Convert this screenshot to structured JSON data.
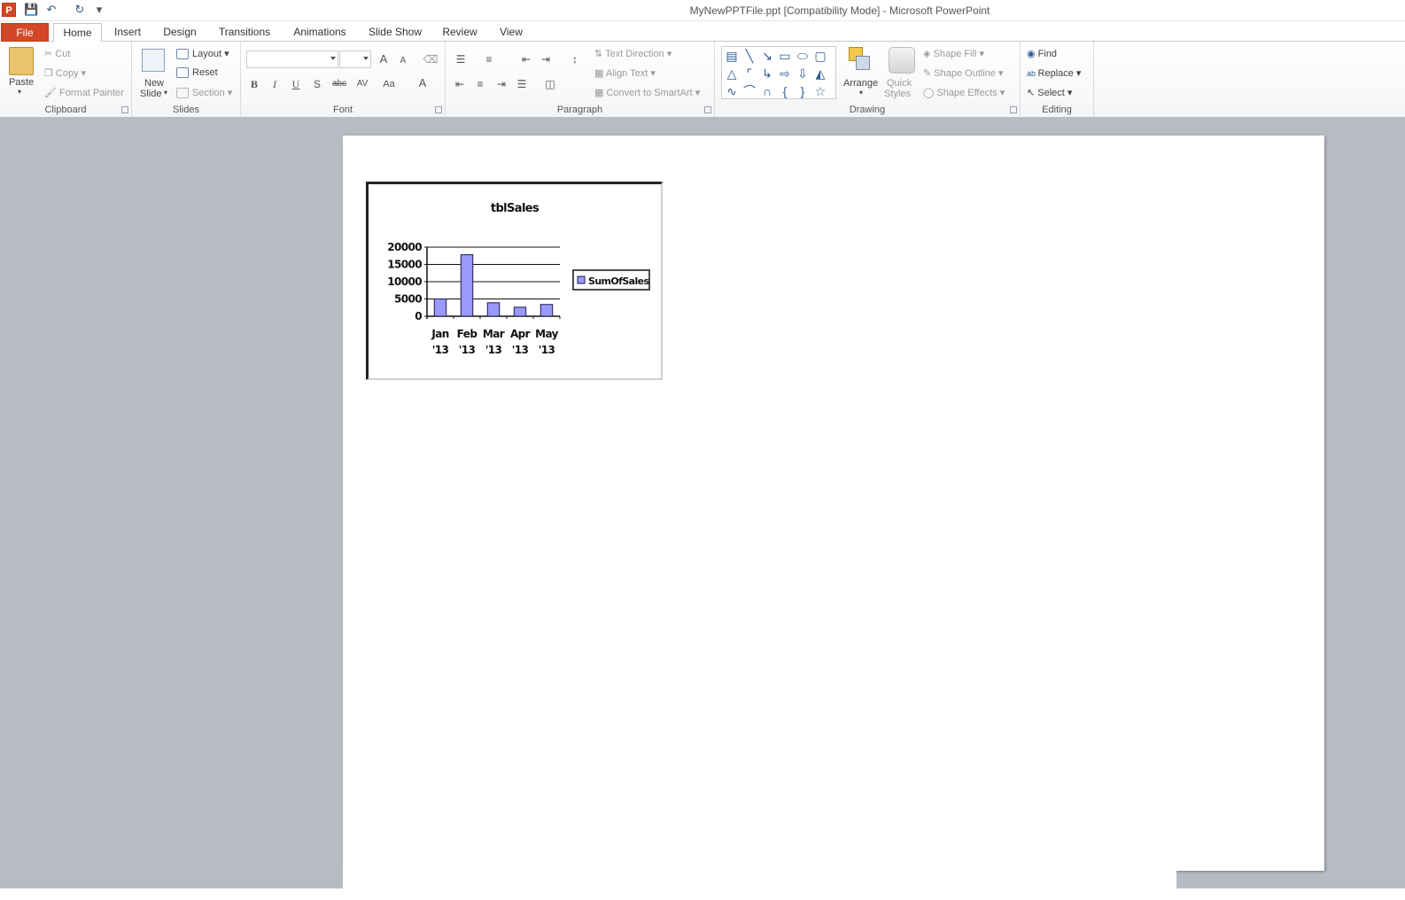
{
  "window": {
    "title": "MyNewPPTFile.ppt [Compatibility Mode]  -  Microsoft PowerPoint",
    "app_icon_letter": "P"
  },
  "tabs": [
    "File",
    "Home",
    "Insert",
    "Design",
    "Transitions",
    "Animations",
    "Slide Show",
    "Review",
    "View"
  ],
  "ribbon": {
    "clipboard": {
      "label": "Clipboard",
      "paste": "Paste",
      "cut": "Cut",
      "copy": "Copy",
      "format_painter": "Format Painter"
    },
    "slides": {
      "label": "Slides",
      "new_slide_1": "New",
      "new_slide_2": "Slide",
      "layout": "Layout",
      "reset": "Reset",
      "section": "Section"
    },
    "font": {
      "label": "Font",
      "bold": "B",
      "italic": "I",
      "underline": "U",
      "shadow": "S",
      "strike": "abc",
      "spacing": "AV",
      "case": "Aa",
      "color": "A",
      "grow": "A",
      "shrink": "A"
    },
    "paragraph": {
      "label": "Paragraph",
      "text_direction": "Text Direction",
      "align_text": "Align Text",
      "convert_smartart": "Convert to SmartArt"
    },
    "drawing": {
      "label": "Drawing",
      "arrange": "Arrange",
      "quick_styles_1": "Quick",
      "quick_styles_2": "Styles",
      "shape_fill": "Shape Fill",
      "shape_outline": "Shape Outline",
      "shape_effects": "Shape Effects"
    },
    "editing": {
      "label": "Editing",
      "find": "Find",
      "replace": "Replace",
      "select": "Select"
    }
  },
  "colors": {
    "file_tab": "#d24726",
    "bar_fill": "#9999ff",
    "bar_stroke": "#1a1a4a"
  },
  "chart_data": {
    "type": "bar",
    "title": "tblSales",
    "categories": [
      "Jan '13",
      "Feb '13",
      "Mar '13",
      "Apr '13",
      "May '13"
    ],
    "category_lines": [
      [
        "Jan",
        "'13"
      ],
      [
        "Feb",
        "'13"
      ],
      [
        "Mar",
        "'13"
      ],
      [
        "Apr",
        "'13"
      ],
      [
        "May",
        "'13"
      ]
    ],
    "series": [
      {
        "name": "SumOfSales",
        "values": [
          5000,
          17800,
          3900,
          2600,
          3400
        ]
      }
    ],
    "yticks": [
      "20000",
      "15000",
      "10000",
      "5000",
      "0"
    ],
    "ylim": [
      0,
      20000
    ],
    "grid": true,
    "legend_position": "right"
  }
}
